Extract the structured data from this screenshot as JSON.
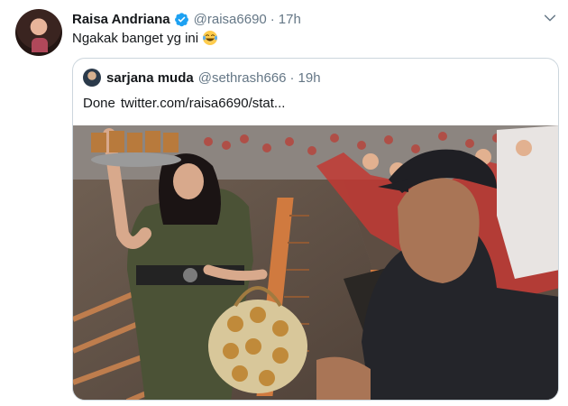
{
  "tweet": {
    "display_name": "Raisa Andriana",
    "handle": "@raisa6690",
    "separator": "·",
    "time": "17h",
    "text": "Ngakak banget yg ini",
    "emoji": "face-with-tears-of-joy",
    "verified": true
  },
  "quoted_tweet": {
    "display_name": "sarjana muda",
    "handle": "@sethrash666",
    "separator": "·",
    "time": "19h",
    "text": "Done",
    "link": "twitter.com/raisa6690/stat..."
  },
  "colors": {
    "text_primary": "#14171a",
    "text_secondary": "#657786",
    "verified_blue": "#1da1f2",
    "border": "#ccd6dd"
  }
}
